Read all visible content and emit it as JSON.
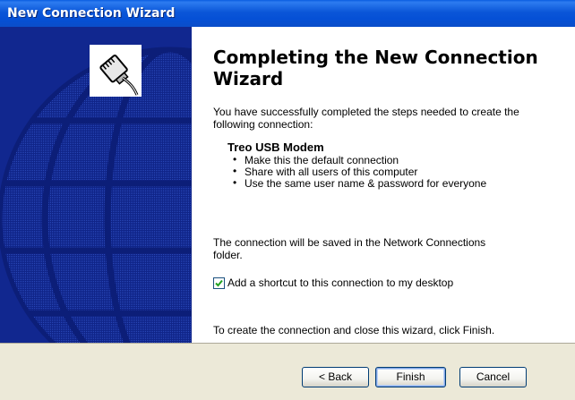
{
  "window": {
    "title": "New Connection Wizard"
  },
  "header": {
    "heading": "Completing the New Connection Wizard"
  },
  "body": {
    "intro": "You have successfully completed the steps needed to create the following connection:",
    "connection_name": "Treo USB Modem",
    "options": [
      "Make this the default connection",
      "Share with all users of this computer",
      "Use the same user name & password for everyone"
    ],
    "saved_note": "The connection will be saved in the Network Connections folder.",
    "shortcut_label": "Add a shortcut to this connection to my desktop",
    "shortcut_checked": true,
    "finish_instruction": "To create the connection and close this wizard, click Finish."
  },
  "buttons": {
    "back": "< Back",
    "finish": "Finish",
    "cancel": "Cancel"
  },
  "colors": {
    "titlebar": "#0a56d8",
    "side_panel": "#11278f",
    "bottom_bar": "#ece9d8",
    "checkmark": "#21a121"
  },
  "icons": {
    "wizard": "network-cable-icon",
    "globe": "globe-graphic"
  }
}
